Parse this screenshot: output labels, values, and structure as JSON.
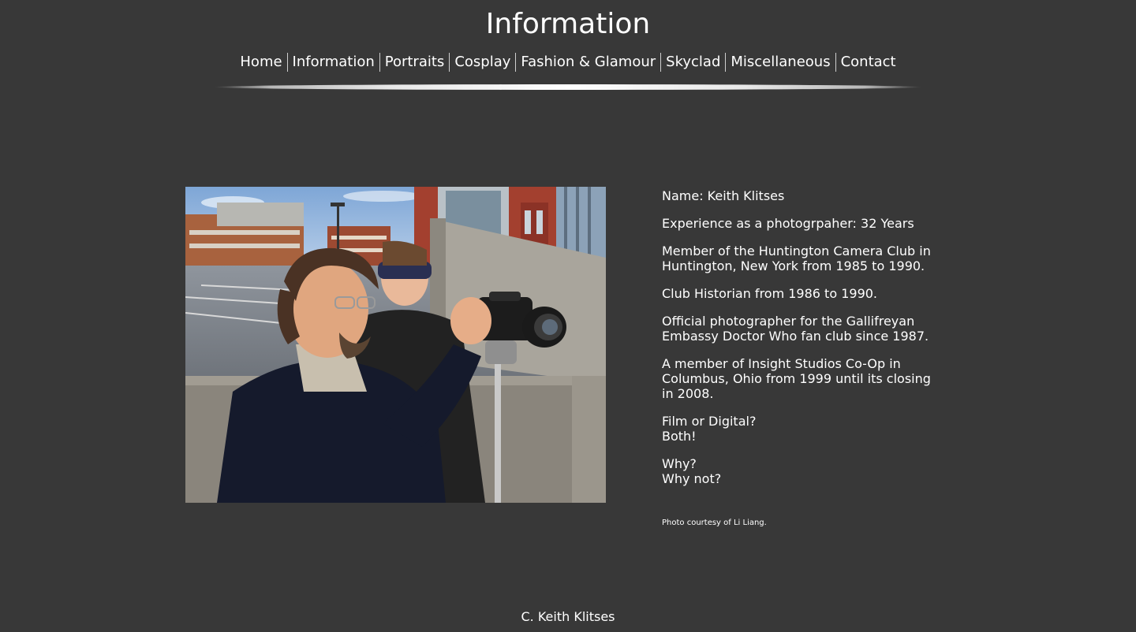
{
  "header": {
    "title": "Information"
  },
  "nav": {
    "items": [
      {
        "label": "Home"
      },
      {
        "label": "Information"
      },
      {
        "label": "Portraits"
      },
      {
        "label": "Cosplay"
      },
      {
        "label": "Fashion & Glamour"
      },
      {
        "label": "Skyclad"
      },
      {
        "label": "Miscellaneous"
      },
      {
        "label": "Contact"
      }
    ]
  },
  "info": {
    "name": "Name: Keith Klitses",
    "experience": "Experience as a photogrpaher: 32 Years",
    "club": "Member of the Huntington Camera Club in Huntington, New York from 1985 to 1990.",
    "historian": "Club Historian from 1986 to 1990.",
    "official": "Official photographer for the Gallifreyan Embassy Doctor Who fan club since 1987.",
    "insight": "A member of Insight Studios Co-Op in Columbus, Ohio from 1999 until its closing in 2008.",
    "film_q": "Film or Digital?",
    "film_a": "Both!",
    "why_q": "Why?",
    "why_a": "Why not?"
  },
  "credit": "Photo courtesy of Li Liang.",
  "footer": "C. Keith Klitses"
}
